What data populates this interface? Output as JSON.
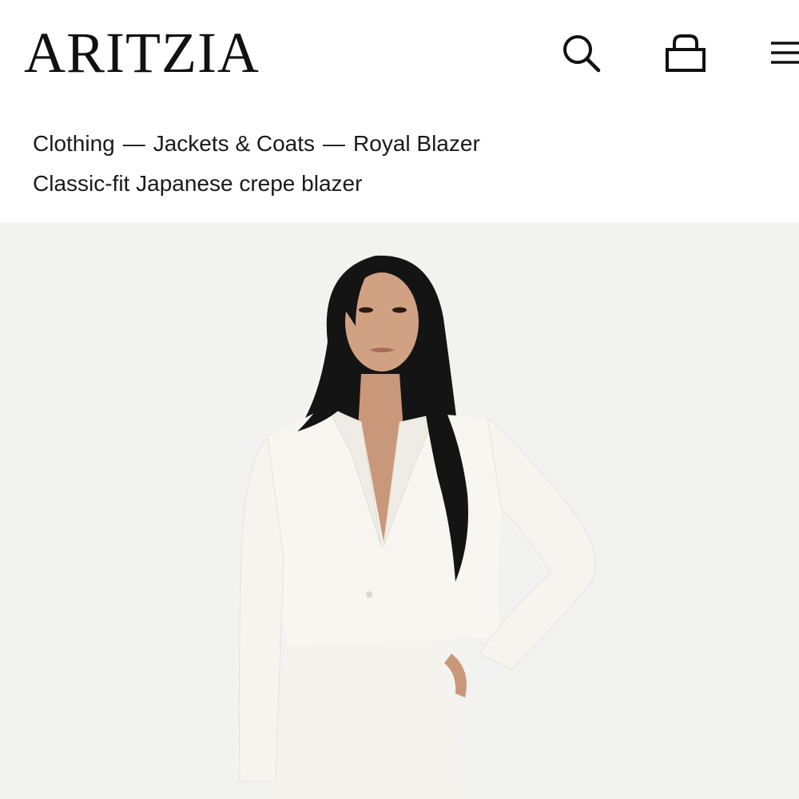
{
  "header": {
    "logo": "ARITZIA",
    "icons": [
      "search-icon",
      "shopping-bag-icon",
      "menu-icon"
    ]
  },
  "breadcrumb": {
    "items": [
      "Clothing",
      "Jackets & Coats",
      "Royal Blazer"
    ],
    "separator": "—"
  },
  "product": {
    "subtitle": "Classic-fit Japanese crepe blazer",
    "image_subject": "model wearing white cropped blazer and white skirt"
  },
  "colors": {
    "background": "#ffffff",
    "hero_background": "#f2f2f1",
    "text": "#1a1a1a",
    "garment": "#f7f5f0",
    "hair": "#141414",
    "skin": "#c9987a"
  }
}
